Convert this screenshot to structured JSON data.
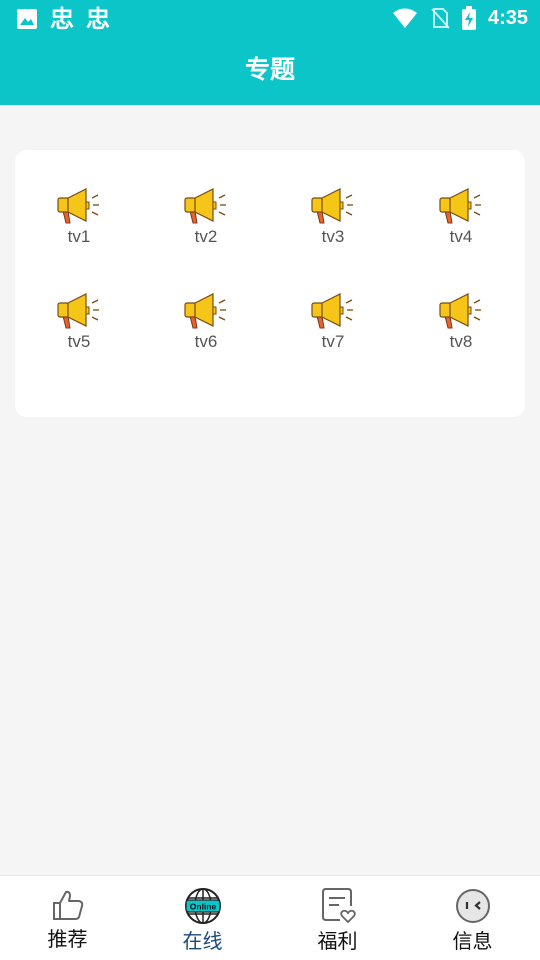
{
  "status_bar": {
    "time": "4:35",
    "notification_text_1": "忠",
    "notification_text_2": "忠",
    "icons": [
      "image-icon",
      "wifi-icon",
      "no-sim-icon",
      "battery-charging-icon"
    ]
  },
  "header": {
    "title": "专题",
    "background_color": "#0bc5c8"
  },
  "topics": {
    "icon": "megaphone-icon",
    "items": [
      {
        "label": "tv1"
      },
      {
        "label": "tv2"
      },
      {
        "label": "tv3"
      },
      {
        "label": "tv4"
      },
      {
        "label": "tv5"
      },
      {
        "label": "tv6"
      },
      {
        "label": "tv7"
      },
      {
        "label": "tv8"
      }
    ]
  },
  "bottom_nav": {
    "items": [
      {
        "label": "推荐",
        "icon": "thumbs-up-icon",
        "active": false
      },
      {
        "label": "在线",
        "icon": "online-globe-icon",
        "active": true,
        "badge_text": "Online"
      },
      {
        "label": "福利",
        "icon": "note-heart-icon",
        "active": false
      },
      {
        "label": "信息",
        "icon": "face-icon",
        "active": false
      }
    ]
  }
}
